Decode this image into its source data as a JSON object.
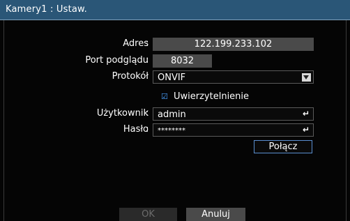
{
  "window": {
    "title": "Kamery1 : Ustaw."
  },
  "form": {
    "colon": ":",
    "address": {
      "label": "Adres",
      "value": "122.199.233.102"
    },
    "preview_port": {
      "label": "Port podglądu",
      "value": "8032"
    },
    "protocol": {
      "label": "Protokół",
      "value": "ONVIF",
      "icon": "dropdown-arrow-icon"
    },
    "authentication": {
      "label": "Uwierzytelnienie",
      "checked": true,
      "icon": "checkbox-checked-icon"
    },
    "username": {
      "label": "Użytkownik",
      "value": "admin",
      "icon": "enter-icon"
    },
    "password": {
      "label": "Hasło",
      "value": "********",
      "icon": "enter-icon"
    },
    "connect_button": "Połącz"
  },
  "footer": {
    "ok_label": "OK",
    "cancel_label": "Anuluj"
  },
  "colors": {
    "titlebar": "#2a5677",
    "field": "#4a4a4a",
    "accent": "#5a8fd0"
  }
}
